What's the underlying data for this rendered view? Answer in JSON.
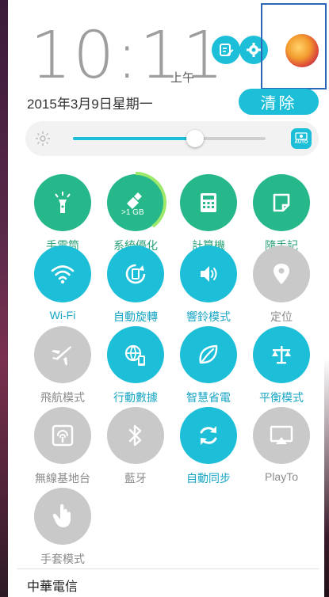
{
  "header": {
    "time": "10:11",
    "ampm": "上午",
    "date": "2015年3月9日星期一",
    "clear_label": "清除",
    "edit_icon": "edit-icon",
    "settings_icon": "gear-icon",
    "avatar_icon": "user-avatar"
  },
  "brightness": {
    "level": 0.5,
    "auto_label": "AUTO",
    "icon": "brightness-icon"
  },
  "memory": {
    "label": ">1 GB",
    "usage_fraction": 0.4
  },
  "tiles": [
    {
      "label": "手電筒",
      "icon": "flashlight-icon",
      "state": "on-green"
    },
    {
      "label": "系統優化",
      "icon": "broom-icon",
      "state": "on-green"
    },
    {
      "label": "計算機",
      "icon": "calculator-icon",
      "state": "on-green"
    },
    {
      "label": "隨手記",
      "icon": "note-icon",
      "state": "on-green"
    },
    {
      "label": "Wi-Fi",
      "icon": "wifi-icon",
      "state": "on-blue"
    },
    {
      "label": "自動旋轉",
      "icon": "rotate-icon",
      "state": "on-blue"
    },
    {
      "label": "響鈴模式",
      "icon": "volume-icon",
      "state": "on-blue"
    },
    {
      "label": "定位",
      "icon": "location-icon",
      "state": "off"
    },
    {
      "label": "飛航模式",
      "icon": "airplane-icon",
      "state": "off"
    },
    {
      "label": "行動數據",
      "icon": "mobile-data-icon",
      "state": "on-blue"
    },
    {
      "label": "智慧省電",
      "icon": "leaf-icon",
      "state": "on-blue"
    },
    {
      "label": "平衡模式",
      "icon": "balance-icon",
      "state": "on-blue"
    },
    {
      "label": "無線基地台",
      "icon": "hotspot-icon",
      "state": "off"
    },
    {
      "label": "藍牙",
      "icon": "bluetooth-icon",
      "state": "off"
    },
    {
      "label": "自動同步",
      "icon": "sync-icon",
      "state": "on-blue"
    },
    {
      "label": "PlayTo",
      "icon": "cast-icon",
      "state": "off"
    },
    {
      "label": "手套模式",
      "icon": "glove-icon",
      "state": "off"
    }
  ],
  "footer": {
    "carrier": "中華電信"
  },
  "colors": {
    "accent_blue": "#1dbfd8",
    "accent_green": "#26b88a",
    "off_gray": "#c9c9c9"
  }
}
